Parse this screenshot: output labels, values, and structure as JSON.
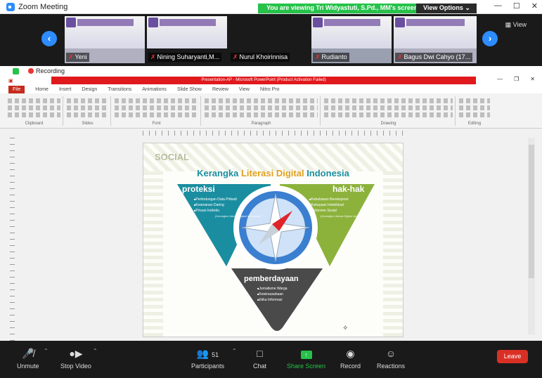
{
  "window": {
    "title": "Zoom Meeting"
  },
  "banner": {
    "viewing": "You are viewing Tri Widyastuti, S.Pd., MM's screen",
    "options": "View Options ⌄"
  },
  "participants_strip": {
    "view_label": "View",
    "tiles": [
      {
        "name": "Yeni"
      },
      {
        "name": "Nining Suharyanti,M..."
      },
      {
        "name": "Nurul Khoirinnisa"
      },
      {
        "name": "Rudianto"
      },
      {
        "name": "Bagus Dwi Cahyo (17..."
      }
    ]
  },
  "status": {
    "recording": "Recording"
  },
  "powerpoint": {
    "title": "Presentation-AP - Microsoft PowerPoint (Product Activation Failed)",
    "menu": [
      "File",
      "Home",
      "Insert",
      "Design",
      "Transitions",
      "Animations",
      "Slide Show",
      "Review",
      "View",
      "Nitro Pro"
    ],
    "ribbon_groups": [
      "Clipboard",
      "Slides",
      "Font",
      "Paragraph",
      "Drawing",
      "Editing"
    ]
  },
  "slide": {
    "social": "SOCIAL",
    "title_part1": "Kerangka",
    "title_part2": "Literasi Digital",
    "title_part3": "Indonesia",
    "left_title": "proteksi",
    "left_items": [
      "Perlindungan Data Pribadi",
      "Keamanan Daring",
      "Privasi Individu"
    ],
    "left_note": "(Kerangka Literasi Digital Indonesia)",
    "right_title": "hak-hak",
    "right_items": [
      "Kebebasan Berekspresi",
      "Kekayaan Intelektual",
      "Aktivisme Sosial"
    ],
    "right_note": "(Kerangka Literasi Digital Indonesia)",
    "bottom_title": "pemberdayaan",
    "bottom_items": [
      "Jurnalisme Warga",
      "Kewirausahaan",
      "Etika Informasi"
    ],
    "colors": {
      "teal": "#1a8ea0",
      "green": "#8cb23c",
      "dark": "#4a4a4a"
    }
  },
  "toolbar": {
    "unmute": "Unmute",
    "stop_video": "Stop Video",
    "participants": "Participants",
    "participants_count": "51",
    "chat": "Chat",
    "share_screen": "Share Screen",
    "record": "Record",
    "reactions": "Reactions",
    "leave": "Leave"
  }
}
